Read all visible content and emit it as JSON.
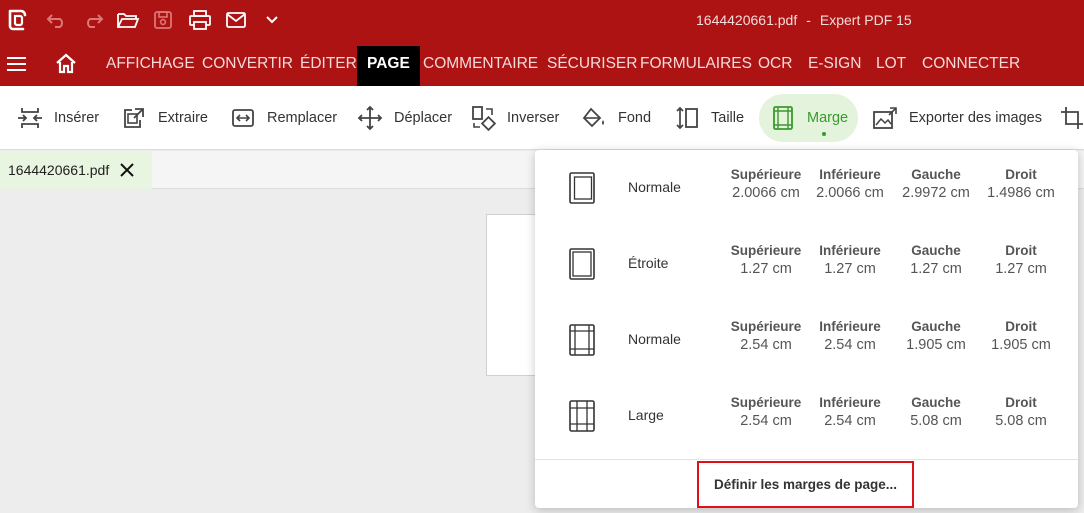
{
  "titlebar": {
    "filename": "1644420661.pdf",
    "separator": "-",
    "app_name": "Expert PDF 15"
  },
  "menu": {
    "items": [
      "AFFICHAGE",
      "CONVERTIR",
      "ÉDITER",
      "PAGE",
      "COMMENTAIRE",
      "SÉCURISER",
      "FORMULAIRES",
      "OCR",
      "E-SIGN",
      "LOT",
      "CONNECTER"
    ],
    "active": "PAGE"
  },
  "ribbon": {
    "tools": [
      "Insérer",
      "Extraire",
      "Remplacer",
      "Déplacer",
      "Inverser",
      "Fond",
      "Taille",
      "Marge",
      "Exporter des images"
    ],
    "active": "Marge"
  },
  "tab": {
    "label": "1644420661.pdf"
  },
  "margins": {
    "headers": {
      "top": "Supérieure",
      "bottom": "Inférieure",
      "left": "Gauche",
      "right": "Droit"
    },
    "presets": [
      {
        "name": "Normale",
        "top": "2.0066 cm",
        "bottom": "2.0066 cm",
        "left": "2.9972 cm",
        "right": "1.4986 cm"
      },
      {
        "name": "Étroite",
        "top": "1.27 cm",
        "bottom": "1.27 cm",
        "left": "1.27 cm",
        "right": "1.27 cm"
      },
      {
        "name": "Normale",
        "top": "2.54 cm",
        "bottom": "2.54 cm",
        "left": "1.905 cm",
        "right": "1.905 cm"
      },
      {
        "name": "Large",
        "top": "2.54 cm",
        "bottom": "2.54 cm",
        "left": "5.08 cm",
        "right": "5.08 cm"
      }
    ],
    "define_label": "Définir les marges de page..."
  },
  "colors": {
    "brand_red": "#ad1313",
    "accent_green": "#3a9a2b",
    "highlight_red": "#e0101a"
  }
}
